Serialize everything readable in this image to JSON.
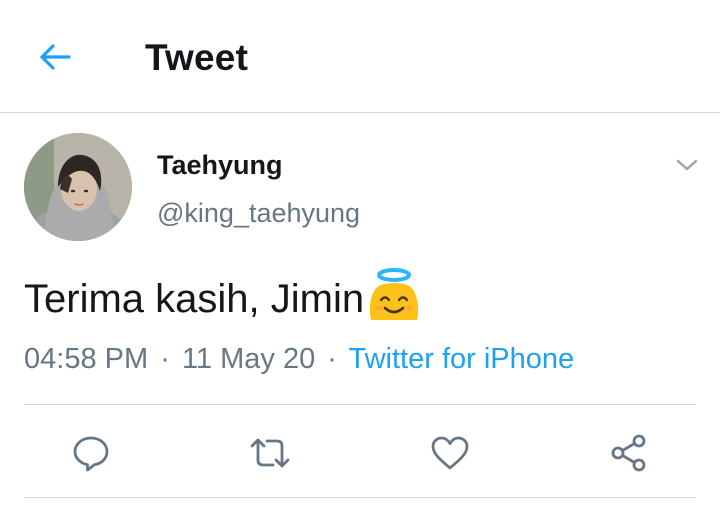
{
  "header": {
    "title": "Tweet",
    "back_icon": "arrow-left-icon"
  },
  "author": {
    "name": "Taehyung",
    "handle": "@king_taehyung"
  },
  "tweet": {
    "text": "Terima kasih, Jimin",
    "emoji": "smiling-face-with-halo"
  },
  "meta": {
    "time": "04:58 PM",
    "separator": "·",
    "date": "11 May 20",
    "source": "Twitter for iPhone"
  },
  "actions": {
    "reply_icon": "reply-icon",
    "retweet_icon": "retweet-icon",
    "like_icon": "heart-icon",
    "share_icon": "share-icon"
  },
  "colors": {
    "accent": "#1da1f2",
    "text": "#14171a",
    "secondary": "#657786",
    "icon": "#657786",
    "divider": "#d9d9d9"
  }
}
